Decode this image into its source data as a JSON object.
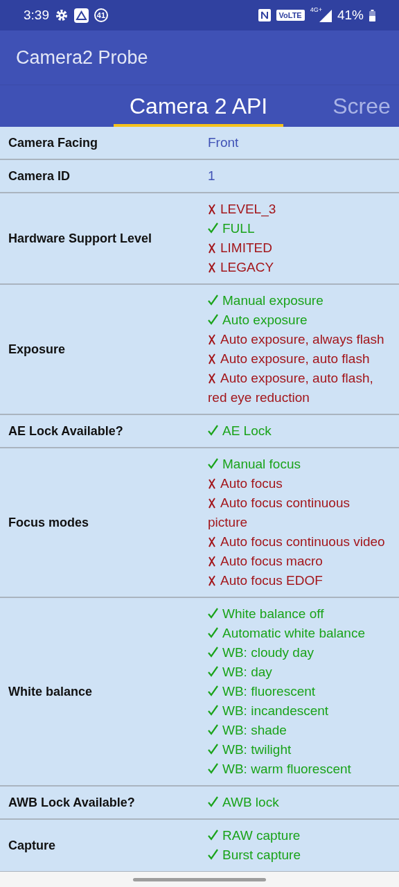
{
  "status_bar": {
    "time": "3:39",
    "notification_count": "41",
    "volte": "VoLTE",
    "network": "4G+",
    "battery": "41%"
  },
  "app_bar": {
    "title": "Camera2 Probe"
  },
  "tabs": [
    {
      "label": "Camera 2 API",
      "selected": true
    },
    {
      "label": "Scree",
      "selected": false
    }
  ],
  "rows": [
    {
      "label": "Camera Facing",
      "kind": "value",
      "value": "Front"
    },
    {
      "label": "Camera ID",
      "kind": "value",
      "value": "1"
    },
    {
      "label": "Hardware Support Level",
      "kind": "features",
      "items": [
        {
          "label": "LEVEL_3",
          "supported": false
        },
        {
          "label": "FULL",
          "supported": true
        },
        {
          "label": "LIMITED",
          "supported": false
        },
        {
          "label": "LEGACY",
          "supported": false
        }
      ]
    },
    {
      "label": "Exposure",
      "kind": "features",
      "items": [
        {
          "label": "Manual exposure",
          "supported": true
        },
        {
          "label": "Auto exposure",
          "supported": true
        },
        {
          "label": "Auto exposure, always flash",
          "supported": false
        },
        {
          "label": "Auto exposure, auto flash",
          "supported": false
        },
        {
          "label": "Auto exposure, auto flash, red eye reduction",
          "supported": false
        }
      ]
    },
    {
      "label": "AE Lock Available?",
      "kind": "features",
      "items": [
        {
          "label": "AE Lock",
          "supported": true
        }
      ]
    },
    {
      "label": "Focus modes",
      "kind": "features",
      "items": [
        {
          "label": "Manual focus",
          "supported": true
        },
        {
          "label": "Auto focus",
          "supported": false
        },
        {
          "label": "Auto focus continuous picture",
          "supported": false
        },
        {
          "label": "Auto focus continuous video",
          "supported": false
        },
        {
          "label": "Auto focus macro",
          "supported": false
        },
        {
          "label": "Auto focus EDOF",
          "supported": false
        }
      ]
    },
    {
      "label": "White balance",
      "kind": "features",
      "items": [
        {
          "label": "White balance off",
          "supported": true
        },
        {
          "label": "Automatic white balance",
          "supported": true
        },
        {
          "label": "WB: cloudy day",
          "supported": true
        },
        {
          "label": "WB: day",
          "supported": true
        },
        {
          "label": "WB: fluorescent",
          "supported": true
        },
        {
          "label": "WB: incandescent",
          "supported": true
        },
        {
          "label": "WB: shade",
          "supported": true
        },
        {
          "label": "WB: twilight",
          "supported": true
        },
        {
          "label": "WB: warm fluorescent",
          "supported": true
        }
      ]
    },
    {
      "label": "AWB Lock Available?",
      "kind": "features",
      "items": [
        {
          "label": "AWB lock",
          "supported": true
        }
      ]
    },
    {
      "label": "Capture",
      "kind": "features",
      "items": [
        {
          "label": "RAW capture",
          "supported": true
        },
        {
          "label": "Burst capture",
          "supported": true
        }
      ]
    }
  ]
}
